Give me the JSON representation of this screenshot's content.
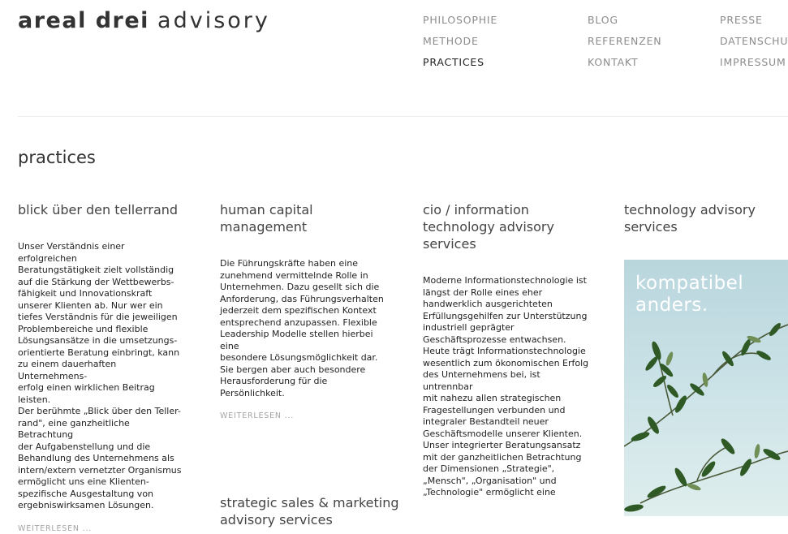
{
  "logo": {
    "bold": "areal drei",
    "light": "advisory"
  },
  "nav": {
    "philosophie": "PHILOSOPHIE",
    "methode": "METHODE",
    "practices": "PRACTICES",
    "blog": "BLOG",
    "referenzen": "REFERENZEN",
    "kontakt": "KONTAKT",
    "presse": "PRESSE",
    "datenschutz": "DATENSCHUTZ",
    "impressum": "IMPRESSUM"
  },
  "page_title": "practices",
  "columns": [
    {
      "title_lines": [
        "blick über den tellerrand"
      ],
      "body_lines": [
        "Unser Verständnis einer erfolgreichen",
        "Beratungstätigkeit zielt vollständig",
        "auf die Stärkung der Wettbewerbs-",
        "fähigkeit und Innovationskraft",
        "unserer Klienten ab. Nur wer ein",
        "tiefes Verständnis für die jeweiligen",
        "Problembereiche und flexible",
        "Lösungsansätze in die umsetzungs-",
        "orientierte Beratung einbringt, kann",
        "zu einem dauerhaften Unternehmens-",
        "erfolg einen wirklichen Beitrag leisten.",
        "Der berühmte „Blick über den Teller-",
        "rand\", eine ganzheitliche Betrachtung",
        "der Aufgabenstellung und die",
        "Behandlung des Unternehmens als",
        "intern/extern vernetzter Organismus",
        "ermöglicht uns eine Klienten-",
        "spezifische Ausgestaltung von",
        "ergebniswirksamen Lösungen."
      ],
      "more": "WEITERLESEN ..."
    },
    {
      "title_lines": [
        "human capital",
        "management"
      ],
      "body_lines": [
        "Die Führungskräfte haben eine",
        "zunehmend vermittelnde Rolle in",
        "Unternehmen. Dazu gesellt sich die",
        "Anforderung, das Führungsverhalten",
        "jederzeit dem spezifischen Kontext",
        "entsprechend anzupassen. Flexible",
        "Leadership Modelle stellen hierbei eine",
        "besondere Lösungsmöglichkeit dar.",
        "Sie bergen aber auch besondere",
        "Herausforderung für die",
        "Persönlichkeit."
      ],
      "more": "WEITERLESEN ..."
    },
    {
      "title_lines": [
        "cio / information",
        "technology advisory",
        "services"
      ],
      "body_lines": [
        "Moderne Informationstechnologie ist",
        "längst der Rolle eines eher",
        "handwerklich ausgerichteten",
        "Erfüllungsgehilfen zur Unterstützung",
        "industriell geprägter",
        "Geschäftsprozesse entwachsen.",
        "Heute trägt Informationstechnologie",
        "wesentlich zum ökonomischen Erfolg",
        "des Unternehmens bei, ist untrennbar",
        "mit nahezu allen strategischen",
        "Fragestellungen verbunden und",
        "integraler Bestandteil neuer",
        "Geschäftsmodelle unserer Klienten.",
        "Unser integrierter Beratungsansatz",
        "mit der ganzheitlichen Betrachtung",
        "der Dimensionen „Strategie\",",
        "„Mensch\", „Organisation\" und",
        "„Technologie\" ermöglicht eine"
      ]
    },
    {
      "title_lines": [
        "technology advisory",
        "services"
      ]
    },
    {
      "title_lines": [
        "strategic sales & marketing",
        "advisory services"
      ]
    }
  ],
  "promo": {
    "lines": [
      "kompatibel",
      "anders."
    ],
    "image": "olive-branch-photo"
  }
}
